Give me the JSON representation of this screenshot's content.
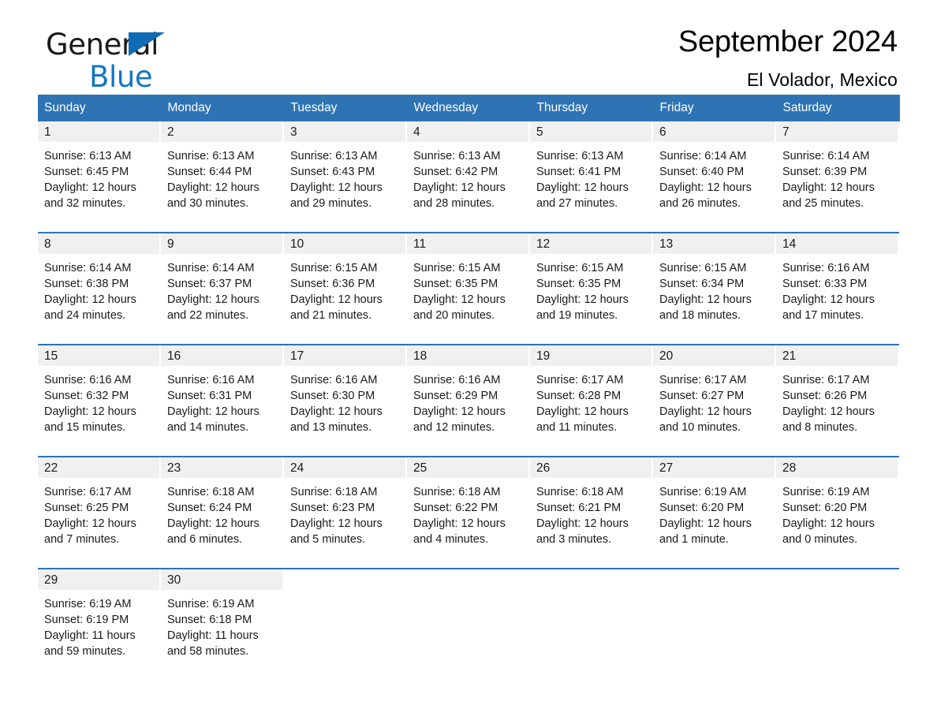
{
  "brand": {
    "name_top": "General",
    "name_bottom": "Blue",
    "triangle_color": "#0f6cb5",
    "blue_color": "#1277c2"
  },
  "header": {
    "title": "September 2024",
    "subtitle": "El Volador, Mexico"
  },
  "theme": {
    "header_blue": "#2e73b4",
    "daynum_gray": "#f0f0f0",
    "text": "#1a1a1a"
  },
  "weekdays": [
    "Sunday",
    "Monday",
    "Tuesday",
    "Wednesday",
    "Thursday",
    "Friday",
    "Saturday"
  ],
  "weeks": [
    [
      {
        "day": "1",
        "sunrise": "Sunrise: 6:13 AM",
        "sunset": "Sunset: 6:45 PM",
        "daylight1": "Daylight: 12 hours",
        "daylight2": "and 32 minutes."
      },
      {
        "day": "2",
        "sunrise": "Sunrise: 6:13 AM",
        "sunset": "Sunset: 6:44 PM",
        "daylight1": "Daylight: 12 hours",
        "daylight2": "and 30 minutes."
      },
      {
        "day": "3",
        "sunrise": "Sunrise: 6:13 AM",
        "sunset": "Sunset: 6:43 PM",
        "daylight1": "Daylight: 12 hours",
        "daylight2": "and 29 minutes."
      },
      {
        "day": "4",
        "sunrise": "Sunrise: 6:13 AM",
        "sunset": "Sunset: 6:42 PM",
        "daylight1": "Daylight: 12 hours",
        "daylight2": "and 28 minutes."
      },
      {
        "day": "5",
        "sunrise": "Sunrise: 6:13 AM",
        "sunset": "Sunset: 6:41 PM",
        "daylight1": "Daylight: 12 hours",
        "daylight2": "and 27 minutes."
      },
      {
        "day": "6",
        "sunrise": "Sunrise: 6:14 AM",
        "sunset": "Sunset: 6:40 PM",
        "daylight1": "Daylight: 12 hours",
        "daylight2": "and 26 minutes."
      },
      {
        "day": "7",
        "sunrise": "Sunrise: 6:14 AM",
        "sunset": "Sunset: 6:39 PM",
        "daylight1": "Daylight: 12 hours",
        "daylight2": "and 25 minutes."
      }
    ],
    [
      {
        "day": "8",
        "sunrise": "Sunrise: 6:14 AM",
        "sunset": "Sunset: 6:38 PM",
        "daylight1": "Daylight: 12 hours",
        "daylight2": "and 24 minutes."
      },
      {
        "day": "9",
        "sunrise": "Sunrise: 6:14 AM",
        "sunset": "Sunset: 6:37 PM",
        "daylight1": "Daylight: 12 hours",
        "daylight2": "and 22 minutes."
      },
      {
        "day": "10",
        "sunrise": "Sunrise: 6:15 AM",
        "sunset": "Sunset: 6:36 PM",
        "daylight1": "Daylight: 12 hours",
        "daylight2": "and 21 minutes."
      },
      {
        "day": "11",
        "sunrise": "Sunrise: 6:15 AM",
        "sunset": "Sunset: 6:35 PM",
        "daylight1": "Daylight: 12 hours",
        "daylight2": "and 20 minutes."
      },
      {
        "day": "12",
        "sunrise": "Sunrise: 6:15 AM",
        "sunset": "Sunset: 6:35 PM",
        "daylight1": "Daylight: 12 hours",
        "daylight2": "and 19 minutes."
      },
      {
        "day": "13",
        "sunrise": "Sunrise: 6:15 AM",
        "sunset": "Sunset: 6:34 PM",
        "daylight1": "Daylight: 12 hours",
        "daylight2": "and 18 minutes."
      },
      {
        "day": "14",
        "sunrise": "Sunrise: 6:16 AM",
        "sunset": "Sunset: 6:33 PM",
        "daylight1": "Daylight: 12 hours",
        "daylight2": "and 17 minutes."
      }
    ],
    [
      {
        "day": "15",
        "sunrise": "Sunrise: 6:16 AM",
        "sunset": "Sunset: 6:32 PM",
        "daylight1": "Daylight: 12 hours",
        "daylight2": "and 15 minutes."
      },
      {
        "day": "16",
        "sunrise": "Sunrise: 6:16 AM",
        "sunset": "Sunset: 6:31 PM",
        "daylight1": "Daylight: 12 hours",
        "daylight2": "and 14 minutes."
      },
      {
        "day": "17",
        "sunrise": "Sunrise: 6:16 AM",
        "sunset": "Sunset: 6:30 PM",
        "daylight1": "Daylight: 12 hours",
        "daylight2": "and 13 minutes."
      },
      {
        "day": "18",
        "sunrise": "Sunrise: 6:16 AM",
        "sunset": "Sunset: 6:29 PM",
        "daylight1": "Daylight: 12 hours",
        "daylight2": "and 12 minutes."
      },
      {
        "day": "19",
        "sunrise": "Sunrise: 6:17 AM",
        "sunset": "Sunset: 6:28 PM",
        "daylight1": "Daylight: 12 hours",
        "daylight2": "and 11 minutes."
      },
      {
        "day": "20",
        "sunrise": "Sunrise: 6:17 AM",
        "sunset": "Sunset: 6:27 PM",
        "daylight1": "Daylight: 12 hours",
        "daylight2": "and 10 minutes."
      },
      {
        "day": "21",
        "sunrise": "Sunrise: 6:17 AM",
        "sunset": "Sunset: 6:26 PM",
        "daylight1": "Daylight: 12 hours",
        "daylight2": "and 8 minutes."
      }
    ],
    [
      {
        "day": "22",
        "sunrise": "Sunrise: 6:17 AM",
        "sunset": "Sunset: 6:25 PM",
        "daylight1": "Daylight: 12 hours",
        "daylight2": "and 7 minutes."
      },
      {
        "day": "23",
        "sunrise": "Sunrise: 6:18 AM",
        "sunset": "Sunset: 6:24 PM",
        "daylight1": "Daylight: 12 hours",
        "daylight2": "and 6 minutes."
      },
      {
        "day": "24",
        "sunrise": "Sunrise: 6:18 AM",
        "sunset": "Sunset: 6:23 PM",
        "daylight1": "Daylight: 12 hours",
        "daylight2": "and 5 minutes."
      },
      {
        "day": "25",
        "sunrise": "Sunrise: 6:18 AM",
        "sunset": "Sunset: 6:22 PM",
        "daylight1": "Daylight: 12 hours",
        "daylight2": "and 4 minutes."
      },
      {
        "day": "26",
        "sunrise": "Sunrise: 6:18 AM",
        "sunset": "Sunset: 6:21 PM",
        "daylight1": "Daylight: 12 hours",
        "daylight2": "and 3 minutes."
      },
      {
        "day": "27",
        "sunrise": "Sunrise: 6:19 AM",
        "sunset": "Sunset: 6:20 PM",
        "daylight1": "Daylight: 12 hours",
        "daylight2": "and 1 minute."
      },
      {
        "day": "28",
        "sunrise": "Sunrise: 6:19 AM",
        "sunset": "Sunset: 6:20 PM",
        "daylight1": "Daylight: 12 hours",
        "daylight2": "and 0 minutes."
      }
    ],
    [
      {
        "day": "29",
        "sunrise": "Sunrise: 6:19 AM",
        "sunset": "Sunset: 6:19 PM",
        "daylight1": "Daylight: 11 hours",
        "daylight2": "and 59 minutes."
      },
      {
        "day": "30",
        "sunrise": "Sunrise: 6:19 AM",
        "sunset": "Sunset: 6:18 PM",
        "daylight1": "Daylight: 11 hours",
        "daylight2": "and 58 minutes."
      },
      {
        "day": "",
        "sunrise": "",
        "sunset": "",
        "daylight1": "",
        "daylight2": ""
      },
      {
        "day": "",
        "sunrise": "",
        "sunset": "",
        "daylight1": "",
        "daylight2": ""
      },
      {
        "day": "",
        "sunrise": "",
        "sunset": "",
        "daylight1": "",
        "daylight2": ""
      },
      {
        "day": "",
        "sunrise": "",
        "sunset": "",
        "daylight1": "",
        "daylight2": ""
      },
      {
        "day": "",
        "sunrise": "",
        "sunset": "",
        "daylight1": "",
        "daylight2": ""
      }
    ]
  ]
}
